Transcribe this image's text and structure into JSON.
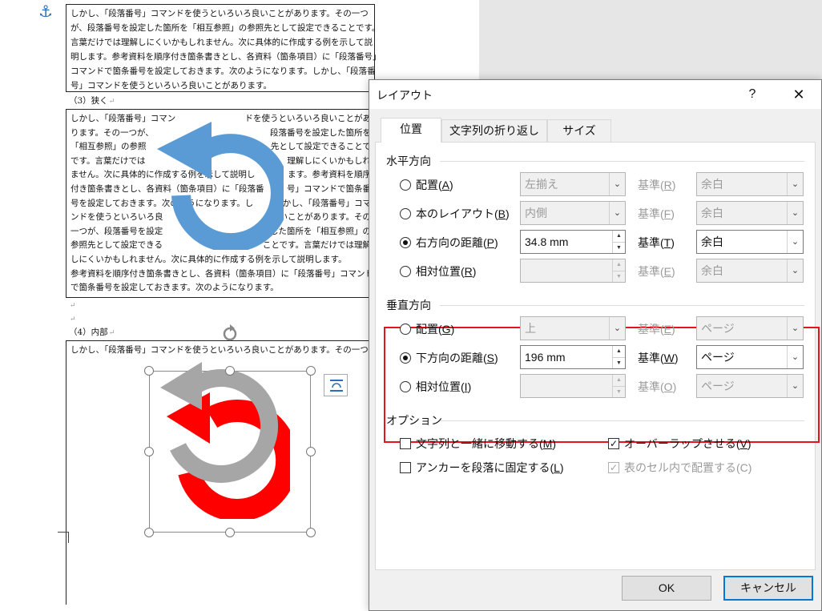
{
  "document": {
    "paragraph1": [
      "しかし、「段落番号」コマンドを使うといろいろ良いことがあります。その一つ",
      "が、段落番号を設定した箇所を「相互参照」の参照先として設定できることです。",
      "言葉だけでは理解しにくいかもしれません。次に具体的に作成する例を示して説",
      "明します。参考資料を順序付き箇条書きとし、各資料（箇条項目）に「段落番号」",
      "コマンドで箇条番号を設定しておきます。次のようになります。しかし、「段落番",
      "号」コマンドを使うといろいろ良いことがあります。"
    ],
    "heading3": "（3）狭く",
    "paragraph2": [
      {
        "left": "しかし、「段落番号」コマン",
        "right": "ドを使うといろいろ良いことがあ"
      },
      {
        "left": "ります。その一つが、",
        "right": "段落番号を設定した箇所を"
      },
      {
        "left": "「相互参照」の参照",
        "right": "先として設定できることで"
      },
      {
        "left": "です。言葉だけでは",
        "right": "理解しにくいかもしれ"
      },
      {
        "left": "ません。次に具体的に作成する例を示して説明し",
        "right": "ます。参考資料を順序"
      },
      {
        "left": "付き箇条書きとし、各資料（箇条項目）に「段落番",
        "right": "号」コマンドで箇条番"
      },
      {
        "left": "号を設定しておきます。次のようになります。し",
        "right": "かし、「段落番号」コマ"
      },
      {
        "left": "ンドを使うといろいろ良",
        "right": "いことがあります。その"
      },
      {
        "left": "一つが、段落番号を設定",
        "right": "した箇所を「相互参照」の"
      },
      {
        "left": "参照先として設定できる",
        "right": "ことです。言葉だけでは理解"
      },
      {
        "left": "しにくいかもしれません。次に具体的に作成する例を示して説明します。",
        "right": ""
      },
      {
        "left": "参考資料を順序付き箇条書きとし、各資料（箇条項目）に「段落番号」コマンド",
        "right": ""
      },
      {
        "left": "で箇条番号を設定しておきます。次のようになります。",
        "right": ""
      }
    ],
    "heading4": "（4）内部",
    "paragraph3_line": "しかし、「段落番号」コマンドを使うといろいろ良いことがあります。その一つ",
    "return_mark": "↵",
    "anchor_icon": "⚓",
    "colors": {
      "blue_arrow": "#5b9bd5",
      "gray_arrow": "#a6a6a6",
      "red_arrow": "#ff0000",
      "red_box": "#e5141c"
    }
  },
  "dialog": {
    "title": "レイアウト",
    "help": "?",
    "close": "✕",
    "tabs": [
      {
        "label": "位置",
        "active": true
      },
      {
        "label": "文字列の折り返し",
        "active": false
      },
      {
        "label": "サイズ",
        "active": false
      }
    ],
    "horizontal": {
      "label": "水平方向",
      "rows": [
        {
          "label": "配置(",
          "key": "A",
          "selected": false,
          "value": "左揃え",
          "base_label": "基準(",
          "base_key": "R",
          "base_value": "余白",
          "enabled": false,
          "control": "dropdown"
        },
        {
          "label": "本のレイアウト(",
          "key": "B",
          "selected": false,
          "value": "内側",
          "base_label": "基準(",
          "base_key": "F",
          "base_value": "余白",
          "enabled": false,
          "control": "dropdown"
        },
        {
          "label": "右方向の距離(",
          "key": "P",
          "selected": true,
          "value": "34.8 mm",
          "base_label": "基準(",
          "base_key": "T",
          "base_value": "余白",
          "enabled": true,
          "control": "spin"
        },
        {
          "label": "相対位置(",
          "key": "R",
          "selected": false,
          "value": "",
          "base_label": "基準(",
          "base_key": "E",
          "base_value": "余白",
          "enabled": false,
          "control": "spin"
        }
      ]
    },
    "vertical": {
      "label": "垂直方向",
      "rows": [
        {
          "label": "配置(",
          "key": "G",
          "selected": false,
          "value": "上",
          "base_label": "基準(",
          "base_key": "E",
          "base_value": "ページ",
          "enabled": false,
          "control": "dropdown"
        },
        {
          "label": "下方向の距離(",
          "key": "S",
          "selected": true,
          "value": "196 mm",
          "base_label": "基準(",
          "base_key": "W",
          "base_value": "ページ",
          "enabled": true,
          "control": "spin"
        },
        {
          "label": "相対位置(",
          "key": "I",
          "selected": false,
          "value": "",
          "base_label": "基準(",
          "base_key": "O",
          "base_value": "ページ",
          "enabled": false,
          "control": "spin"
        }
      ]
    },
    "options": {
      "label": "オプション",
      "move_with_text": {
        "label": "文字列と一緒に移動する(",
        "key": "M",
        "checked": false
      },
      "lock_anchor": {
        "label": "アンカーを段落に固定する(",
        "key": "L",
        "checked": false
      },
      "allow_overlap": {
        "label": "オーバーラップさせる(",
        "key": "V",
        "checked": true
      },
      "layout_in_cell": {
        "label": "表のセル内で配置する(C)",
        "checked": true,
        "enabled": false
      }
    },
    "ok": "OK",
    "cancel": "キャンセル"
  }
}
